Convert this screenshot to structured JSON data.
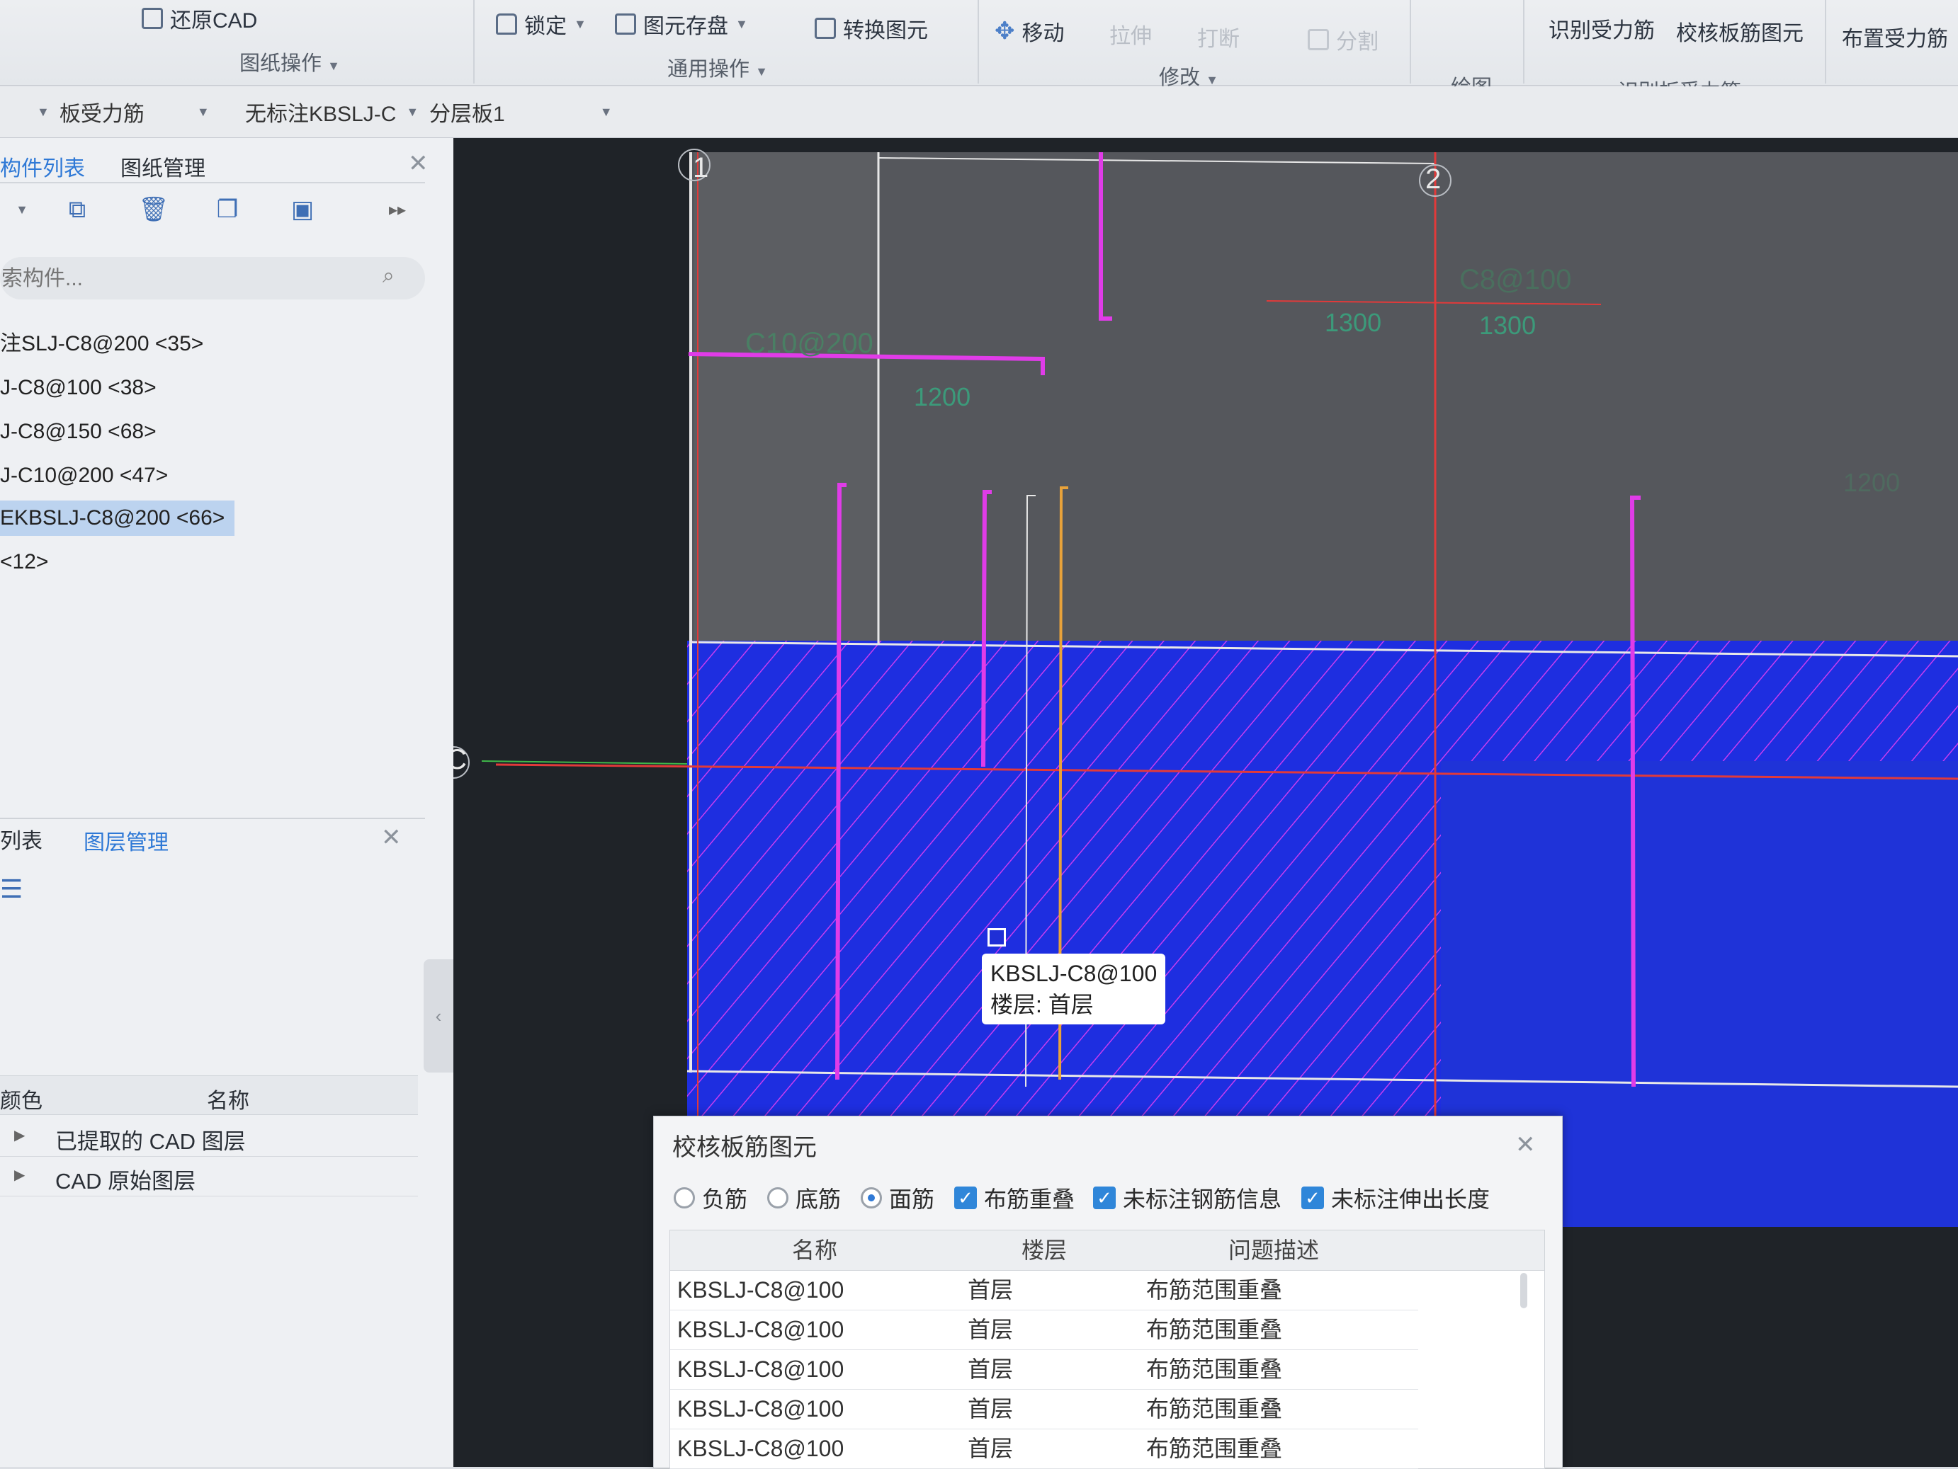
{
  "ribbon": {
    "restore_cad": "还原CAD",
    "drawing_ops": "图纸操作",
    "lock": "锁定",
    "element_save": "图元存盘",
    "convert_element": "转换图元",
    "general_ops": "通用操作",
    "move": "移动",
    "stretch": "拉伸",
    "break": "打断",
    "split": "分割",
    "modify": "修改",
    "draw": "绘图",
    "recognize_rebar": "识别受力筋",
    "check_slab_rebar": "校核板筋图元",
    "recognize_slab_rebar": "识别板受力筋",
    "place_rebar": "布置受力筋"
  },
  "propbar": {
    "combo1": "板受力筋",
    "combo2": "无标注KBSLJ-C",
    "combo3": "分层板1"
  },
  "left_panel": {
    "tab_component_list": "构件列表",
    "tab_drawing_mgmt": "图纸管理",
    "search_placeholder": "索构件...",
    "items": [
      "注SLJ-C8@200 <35>",
      "J-C8@100 <38>",
      "J-C8@150 <68>",
      "J-C10@200 <47>",
      "EKBSLJ-C8@200 <66>",
      "<12>"
    ],
    "tab_list": "列表",
    "tab_layer_mgmt": "图层管理",
    "col_color": "颜色",
    "col_name": "名称",
    "layers": [
      "已提取的 CAD 图层",
      "CAD 原始图层"
    ]
  },
  "canvas": {
    "axis_1": "1",
    "axis_2": "2",
    "axis_c": "C",
    "labels": [
      "C10@200",
      "1200",
      "C8@100",
      "1300",
      "1300",
      "1200"
    ],
    "tooltip_line1": "KBSLJ-C8@100",
    "tooltip_line2": "楼层: 首层"
  },
  "dialog": {
    "title": "校核板筋图元",
    "options": [
      "负筋",
      "底筋",
      "面筋",
      "布筋重叠",
      "未标注钢筋信息",
      "未标注伸出长度"
    ],
    "selected_radio": "面筋",
    "columns": [
      "名称",
      "楼层",
      "问题描述"
    ],
    "rows": [
      {
        "name": "KBSLJ-C8@100",
        "floor": "首层",
        "issue": "布筋范围重叠"
      },
      {
        "name": "KBSLJ-C8@100",
        "floor": "首层",
        "issue": "布筋范围重叠"
      },
      {
        "name": "KBSLJ-C8@100",
        "floor": "首层",
        "issue": "布筋范围重叠"
      },
      {
        "name": "KBSLJ-C8@100",
        "floor": "首层",
        "issue": "布筋范围重叠"
      },
      {
        "name": "KBSLJ-C8@100",
        "floor": "首层",
        "issue": "布筋范围重叠"
      }
    ]
  },
  "colors": {
    "accent": "#2f79d6",
    "slab_fill": "#1f2fd6",
    "rebar_magenta": "#e03ce8",
    "axis_red": "#e23a3a",
    "canvas_bg": "#1f2328"
  }
}
